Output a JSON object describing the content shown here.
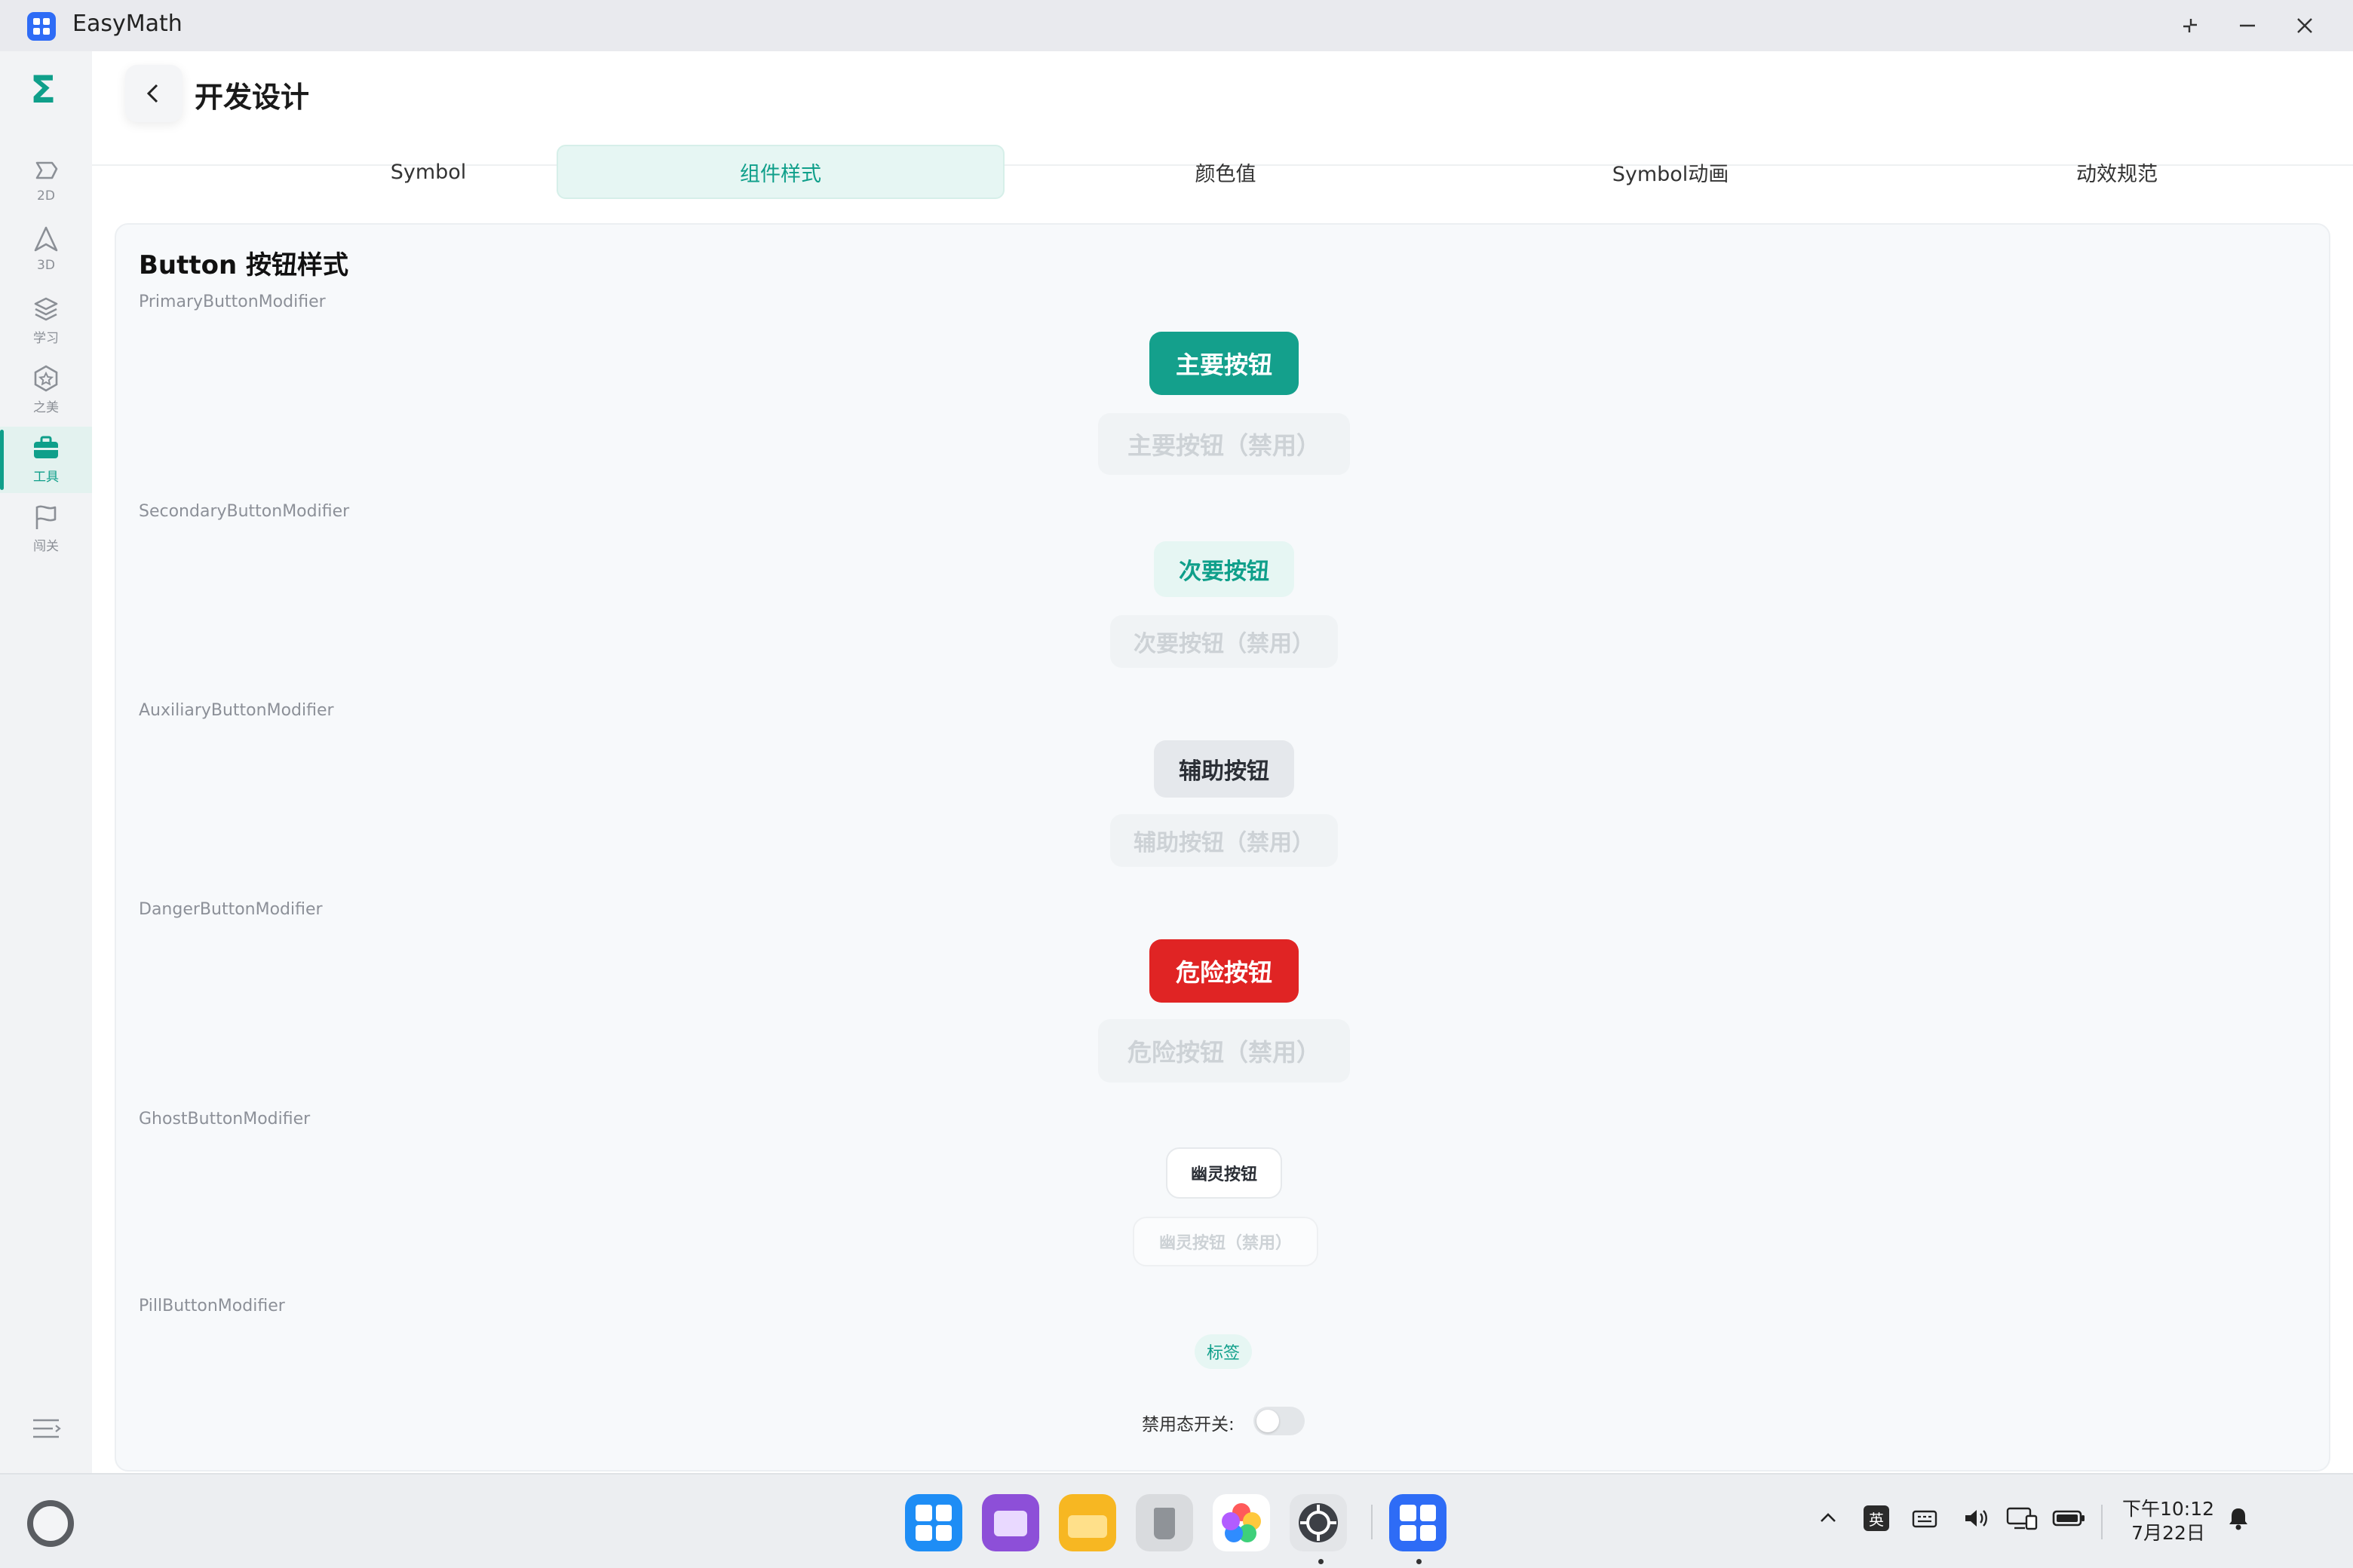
{
  "window": {
    "title": "EasyMath"
  },
  "rail": {
    "items": [
      {
        "label": "2D",
        "icon": "shape-2d-icon"
      },
      {
        "label": "3D",
        "icon": "cone-3d-icon"
      },
      {
        "label": "学习",
        "icon": "layers-icon"
      },
      {
        "label": "之美",
        "icon": "hexagon-star-icon"
      },
      {
        "label": "工具",
        "icon": "toolbox-icon",
        "active": true
      },
      {
        "label": "闯关",
        "icon": "flag-icon"
      }
    ]
  },
  "header": {
    "title": "开发设计"
  },
  "tabs": [
    {
      "label": "Symbol"
    },
    {
      "label": "组件样式",
      "active": true
    },
    {
      "label": "颜色值"
    },
    {
      "label": "Symbol动画"
    },
    {
      "label": "动效规范"
    }
  ],
  "card": {
    "title": "Button 按钮样式",
    "sections": {
      "primary": {
        "modifier": "PrimaryButtonModifier",
        "label": "主要按钮",
        "disabled_label": "主要按钮（禁用）"
      },
      "secondary": {
        "modifier": "SecondaryButtonModifier",
        "label": "次要按钮",
        "disabled_label": "次要按钮（禁用）"
      },
      "auxiliary": {
        "modifier": "AuxiliaryButtonModifier",
        "label": "辅助按钮",
        "disabled_label": "辅助按钮（禁用）"
      },
      "danger": {
        "modifier": "DangerButtonModifier",
        "label": "危险按钮",
        "disabled_label": "危险按钮（禁用）"
      },
      "ghost": {
        "modifier": "GhostButtonModifier",
        "label": "幽灵按钮",
        "disabled_label": "幽灵按钮（禁用）"
      },
      "pill": {
        "modifier": "PillButtonModifier",
        "label": "标签"
      }
    },
    "toggle": {
      "label": "禁用态开关:",
      "on": false
    }
  },
  "taskbar": {
    "tray": {
      "ime": "英"
    },
    "clock": {
      "time": "下午10:12",
      "date": "7月22日"
    }
  },
  "colors": {
    "accent": "#14a08c",
    "danger": "#e02424",
    "brand_blue": "#2e6cf6"
  }
}
